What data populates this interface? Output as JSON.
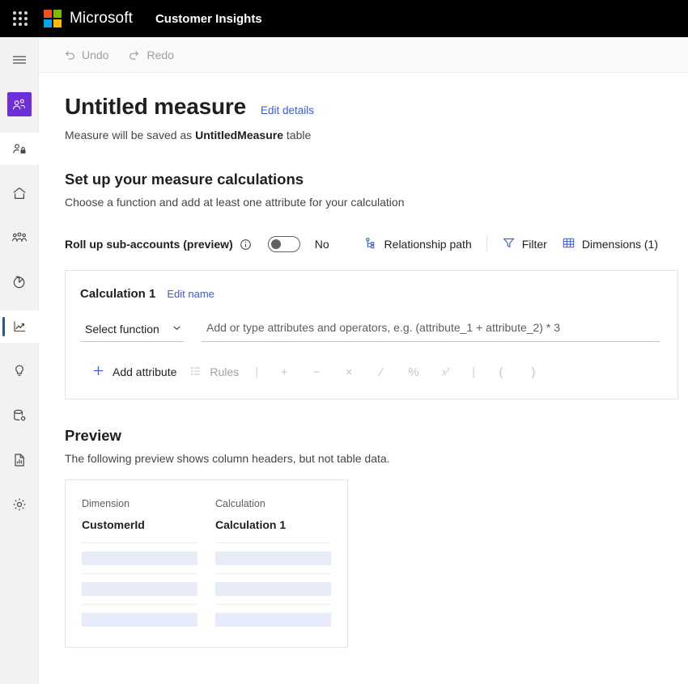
{
  "topbar": {
    "waffle_icon": "app-launcher-icon",
    "brand": "Microsoft",
    "app_title": "Customer Insights"
  },
  "rail": {
    "items": [
      {
        "name": "hamburger-menu-icon",
        "label": "Menu"
      },
      {
        "name": "people-icon",
        "label": "Customers",
        "state": "active-tile"
      },
      {
        "name": "people-lock-icon",
        "label": "Consent",
        "state": "hover"
      },
      {
        "name": "home-icon",
        "label": "Home"
      },
      {
        "name": "audience-insights-icon",
        "label": "Segments"
      },
      {
        "name": "pie-chart-icon",
        "label": "Analytics"
      },
      {
        "name": "trending-chart-icon",
        "label": "Measures",
        "state": "selected"
      },
      {
        "name": "lightbulb-icon",
        "label": "Intelligence"
      },
      {
        "name": "database-gear-icon",
        "label": "Data"
      },
      {
        "name": "report-icon",
        "label": "Reports"
      },
      {
        "name": "gear-icon",
        "label": "Settings"
      }
    ]
  },
  "commandbar": {
    "undo_label": "Undo",
    "redo_label": "Redo"
  },
  "page": {
    "title": "Untitled measure",
    "edit_details_label": "Edit details",
    "subtitle_prefix": "Measure will be saved as ",
    "subtitle_table": "UntitledMeasure",
    "subtitle_suffix": " table",
    "section_title": "Set up your measure calculations",
    "section_subtitle": "Choose a function and add at least one attribute for your calculation"
  },
  "options": {
    "rollup_label": "Roll up sub-accounts (preview)",
    "info_icon": "info-icon",
    "toggle_state": "off",
    "toggle_text": "No",
    "relationship_path_label": "Relationship path",
    "filter_label": "Filter",
    "dimensions_label": "Dimensions (1)"
  },
  "calculation": {
    "name": "Calculation 1",
    "edit_name_label": "Edit name",
    "select_function_label": "Select function",
    "formula_placeholder": "Add or type attributes and operators, e.g. (attribute_1 + attribute_2) * 3",
    "formula_value": "",
    "add_attribute_label": "Add attribute",
    "rules_label": "Rules",
    "operators": [
      "+",
      "−",
      "×",
      "∕",
      "%",
      "x^y",
      "|",
      "(",
      ")"
    ]
  },
  "preview": {
    "title": "Preview",
    "subtitle": "The following preview shows column headers, but not table data.",
    "columns": [
      {
        "header": "Dimension",
        "name": "CustomerId"
      },
      {
        "header": "Calculation",
        "name": "Calculation 1"
      }
    ],
    "skeleton_rows": 3
  },
  "colors": {
    "accent_blue": "#3b5bdb",
    "brand_purple": "#6c2fd9",
    "nav_selected": "#2b579a",
    "skeleton": "#e8ecf9",
    "topbar_bg": "#000000"
  }
}
